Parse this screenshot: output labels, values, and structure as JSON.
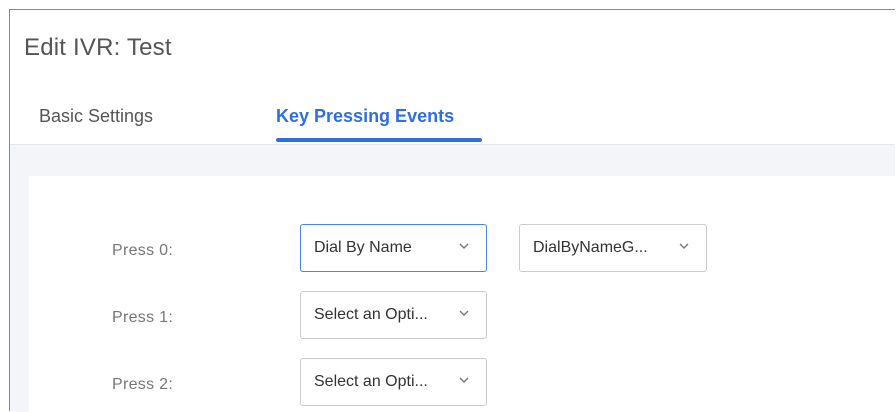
{
  "window": {
    "title": "Edit IVR: Test"
  },
  "tabs": [
    {
      "label": "Basic Settings",
      "active": false
    },
    {
      "label": "Key Pressing Events",
      "active": true
    }
  ],
  "rows": [
    {
      "label": "Press 0:",
      "action_select": {
        "value": "Dial By Name",
        "icon": "chevron-down-icon"
      },
      "target_select": {
        "value": "DialByNameG...",
        "icon": "chevron-down-icon"
      }
    },
    {
      "label": "Press 1:",
      "action_select": {
        "value": "Select an Opti...",
        "icon": "chevron-down-icon"
      }
    },
    {
      "label": "Press 2:",
      "action_select": {
        "value": "Select an Opti...",
        "icon": "chevron-down-icon"
      }
    }
  ],
  "colors": {
    "accent": "#2e6fe0",
    "window_border": "#5b8fd6",
    "content_background": "#f3f5f8"
  }
}
